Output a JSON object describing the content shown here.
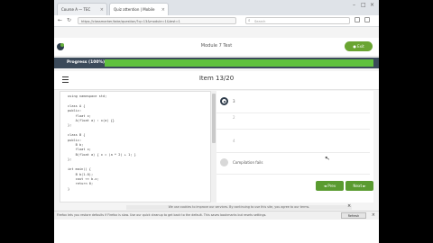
{
  "browser": {
    "tabs": [
      {
        "label": "Course A — TEC",
        "active": false
      },
      {
        "label": "Quiz attention | Mobile",
        "active": true
      }
    ],
    "url": "https://classmarker/take/question/?q=13&module=1&test=1",
    "search_placeholder": "Search"
  },
  "app": {
    "title": "Module 7 Test",
    "exit_label": "● Exit",
    "brand_color": "#6aa532"
  },
  "progress": {
    "label": "Progress (100%)",
    "percent": 100,
    "fill_color": "#5fc13e"
  },
  "question": {
    "item_label": "Item 13/20",
    "code_lines": [
      "using namespace std;",
      "",
      "class A {",
      "public:",
      "    float x;",
      "    A(float a) : x(a) {}",
      "};",
      "",
      "class B {",
      "public:",
      "    B b;",
      "    float x;",
      "    B(float a) { x = (a * 2) + 1; }",
      "};",
      "",
      "int main() {",
      "    B b(1.0);",
      "    cout << b.x;",
      "    return 0;",
      "}"
    ]
  },
  "answers": {
    "options": [
      {
        "label": "3",
        "selected": true
      },
      {
        "label": "2",
        "selected": false
      },
      {
        "label": "4",
        "selected": false
      },
      {
        "label": "Compilation fails",
        "selected": false
      }
    ]
  },
  "nav": {
    "prev_label": "◄ Prev",
    "next_label": "Next ►"
  },
  "footer": {
    "note": "We use cookies to improve our services. By continuing to use this site, you agree to our terms."
  },
  "notification": {
    "text": "Firefox lets you restore defaults if Firefox is slow. Use our quick cleanup to get back to the default. This saves bookmarks but resets settings.",
    "button_label": "Refresh Firefox..."
  }
}
